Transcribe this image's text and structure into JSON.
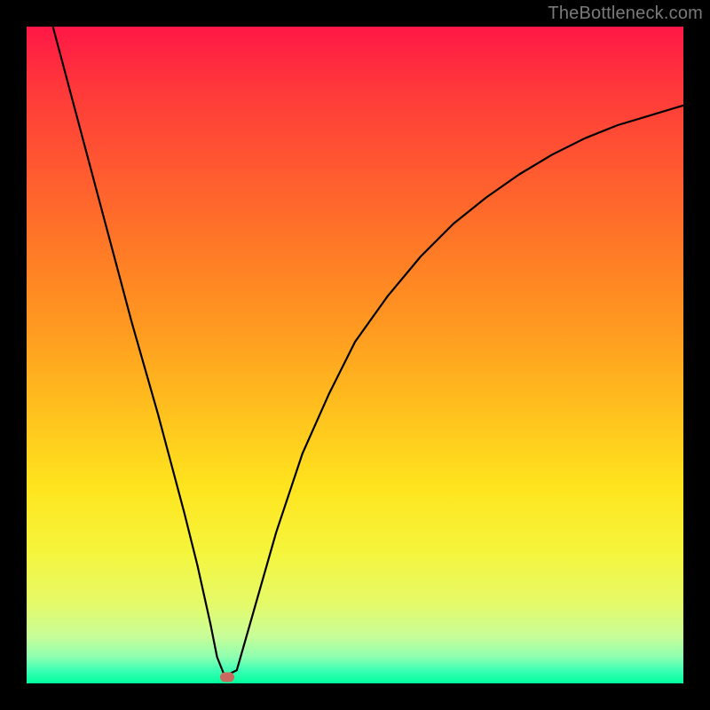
{
  "watermark": "TheBottleneck.com",
  "chart_data": {
    "type": "line",
    "title": "",
    "xlabel": "",
    "ylabel": "",
    "xlim": [
      0,
      100
    ],
    "ylim": [
      0,
      100
    ],
    "grid": false,
    "legend": false,
    "marker": {
      "x": 30.5,
      "y": 1.0,
      "color": "#c96a5e"
    },
    "series": [
      {
        "name": "curve",
        "color": "#000000",
        "x": [
          4,
          8,
          12,
          16,
          20,
          24,
          26,
          28,
          29,
          30,
          31,
          32,
          34,
          38,
          42,
          46,
          50,
          55,
          60,
          65,
          70,
          75,
          80,
          85,
          90,
          95,
          100
        ],
        "y": [
          100,
          85,
          70,
          55,
          41,
          26,
          18,
          9,
          4,
          1.5,
          1.5,
          2,
          9,
          23,
          35,
          44,
          52,
          59,
          65,
          70,
          74,
          77.5,
          80.5,
          83,
          85,
          86.5,
          88
        ]
      }
    ]
  }
}
